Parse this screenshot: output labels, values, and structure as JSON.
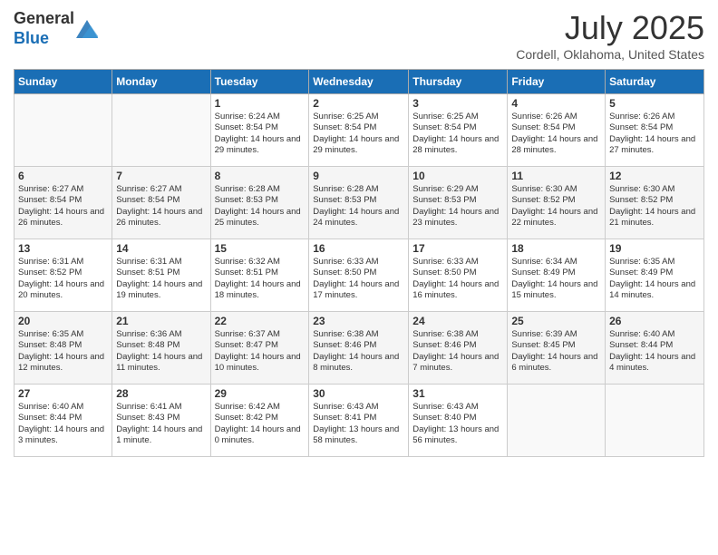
{
  "header": {
    "logo_general": "General",
    "logo_blue": "Blue",
    "title": "July 2025",
    "location": "Cordell, Oklahoma, United States"
  },
  "days_of_week": [
    "Sunday",
    "Monday",
    "Tuesday",
    "Wednesday",
    "Thursday",
    "Friday",
    "Saturday"
  ],
  "weeks": [
    [
      {
        "num": "",
        "content": ""
      },
      {
        "num": "",
        "content": ""
      },
      {
        "num": "1",
        "content": "Sunrise: 6:24 AM\nSunset: 8:54 PM\nDaylight: 14 hours and 29 minutes."
      },
      {
        "num": "2",
        "content": "Sunrise: 6:25 AM\nSunset: 8:54 PM\nDaylight: 14 hours and 29 minutes."
      },
      {
        "num": "3",
        "content": "Sunrise: 6:25 AM\nSunset: 8:54 PM\nDaylight: 14 hours and 28 minutes."
      },
      {
        "num": "4",
        "content": "Sunrise: 6:26 AM\nSunset: 8:54 PM\nDaylight: 14 hours and 28 minutes."
      },
      {
        "num": "5",
        "content": "Sunrise: 6:26 AM\nSunset: 8:54 PM\nDaylight: 14 hours and 27 minutes."
      }
    ],
    [
      {
        "num": "6",
        "content": "Sunrise: 6:27 AM\nSunset: 8:54 PM\nDaylight: 14 hours and 26 minutes."
      },
      {
        "num": "7",
        "content": "Sunrise: 6:27 AM\nSunset: 8:54 PM\nDaylight: 14 hours and 26 minutes."
      },
      {
        "num": "8",
        "content": "Sunrise: 6:28 AM\nSunset: 8:53 PM\nDaylight: 14 hours and 25 minutes."
      },
      {
        "num": "9",
        "content": "Sunrise: 6:28 AM\nSunset: 8:53 PM\nDaylight: 14 hours and 24 minutes."
      },
      {
        "num": "10",
        "content": "Sunrise: 6:29 AM\nSunset: 8:53 PM\nDaylight: 14 hours and 23 minutes."
      },
      {
        "num": "11",
        "content": "Sunrise: 6:30 AM\nSunset: 8:52 PM\nDaylight: 14 hours and 22 minutes."
      },
      {
        "num": "12",
        "content": "Sunrise: 6:30 AM\nSunset: 8:52 PM\nDaylight: 14 hours and 21 minutes."
      }
    ],
    [
      {
        "num": "13",
        "content": "Sunrise: 6:31 AM\nSunset: 8:52 PM\nDaylight: 14 hours and 20 minutes."
      },
      {
        "num": "14",
        "content": "Sunrise: 6:31 AM\nSunset: 8:51 PM\nDaylight: 14 hours and 19 minutes."
      },
      {
        "num": "15",
        "content": "Sunrise: 6:32 AM\nSunset: 8:51 PM\nDaylight: 14 hours and 18 minutes."
      },
      {
        "num": "16",
        "content": "Sunrise: 6:33 AM\nSunset: 8:50 PM\nDaylight: 14 hours and 17 minutes."
      },
      {
        "num": "17",
        "content": "Sunrise: 6:33 AM\nSunset: 8:50 PM\nDaylight: 14 hours and 16 minutes."
      },
      {
        "num": "18",
        "content": "Sunrise: 6:34 AM\nSunset: 8:49 PM\nDaylight: 14 hours and 15 minutes."
      },
      {
        "num": "19",
        "content": "Sunrise: 6:35 AM\nSunset: 8:49 PM\nDaylight: 14 hours and 14 minutes."
      }
    ],
    [
      {
        "num": "20",
        "content": "Sunrise: 6:35 AM\nSunset: 8:48 PM\nDaylight: 14 hours and 12 minutes."
      },
      {
        "num": "21",
        "content": "Sunrise: 6:36 AM\nSunset: 8:48 PM\nDaylight: 14 hours and 11 minutes."
      },
      {
        "num": "22",
        "content": "Sunrise: 6:37 AM\nSunset: 8:47 PM\nDaylight: 14 hours and 10 minutes."
      },
      {
        "num": "23",
        "content": "Sunrise: 6:38 AM\nSunset: 8:46 PM\nDaylight: 14 hours and 8 minutes."
      },
      {
        "num": "24",
        "content": "Sunrise: 6:38 AM\nSunset: 8:46 PM\nDaylight: 14 hours and 7 minutes."
      },
      {
        "num": "25",
        "content": "Sunrise: 6:39 AM\nSunset: 8:45 PM\nDaylight: 14 hours and 6 minutes."
      },
      {
        "num": "26",
        "content": "Sunrise: 6:40 AM\nSunset: 8:44 PM\nDaylight: 14 hours and 4 minutes."
      }
    ],
    [
      {
        "num": "27",
        "content": "Sunrise: 6:40 AM\nSunset: 8:44 PM\nDaylight: 14 hours and 3 minutes."
      },
      {
        "num": "28",
        "content": "Sunrise: 6:41 AM\nSunset: 8:43 PM\nDaylight: 14 hours and 1 minute."
      },
      {
        "num": "29",
        "content": "Sunrise: 6:42 AM\nSunset: 8:42 PM\nDaylight: 14 hours and 0 minutes."
      },
      {
        "num": "30",
        "content": "Sunrise: 6:43 AM\nSunset: 8:41 PM\nDaylight: 13 hours and 58 minutes."
      },
      {
        "num": "31",
        "content": "Sunrise: 6:43 AM\nSunset: 8:40 PM\nDaylight: 13 hours and 56 minutes."
      },
      {
        "num": "",
        "content": ""
      },
      {
        "num": "",
        "content": ""
      }
    ]
  ]
}
